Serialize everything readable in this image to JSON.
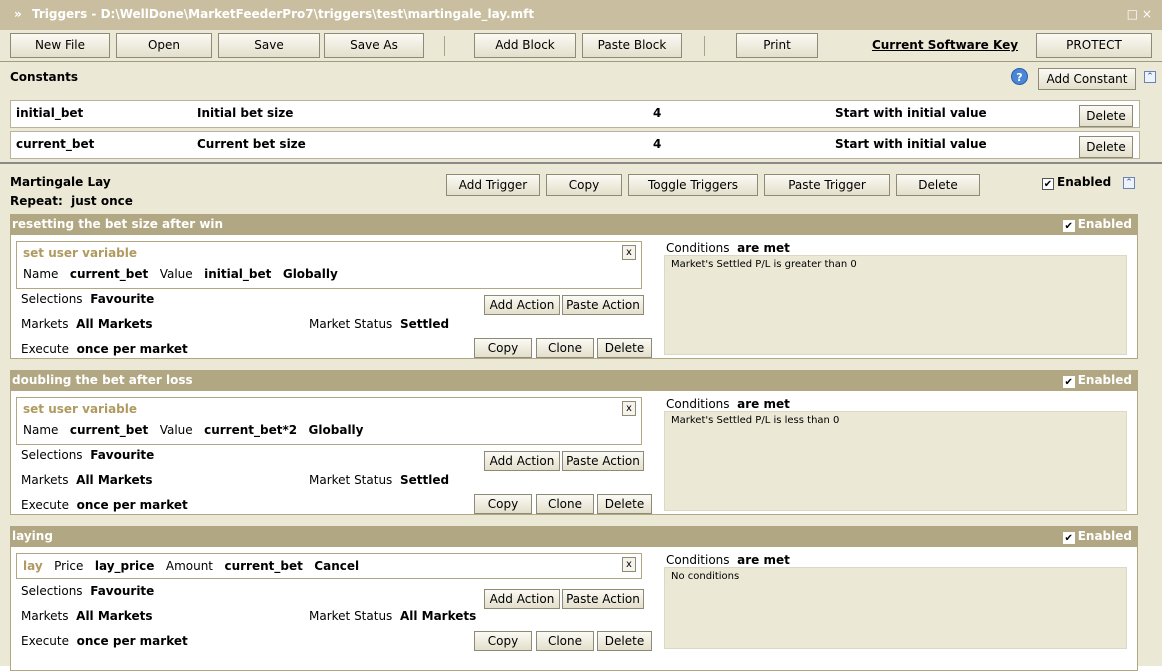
{
  "window": {
    "icon": "»",
    "title": "Triggers - D:\\WellDone\\MarketFeederPro7\\triggers\\test\\martingale_lay.mft",
    "controls": "□ ×"
  },
  "toolbar": {
    "new_file": "New File",
    "open": "Open",
    "save": "Save",
    "save_as": "Save As",
    "add_block": "Add Block",
    "paste_block": "Paste Block",
    "print": "Print",
    "current_key": "Current Software Key",
    "protect": "PROTECT"
  },
  "constants": {
    "title": "Constants",
    "help": "?",
    "add_constant": "Add Constant",
    "collapse": "⌃",
    "rows": [
      {
        "name": "initial_bet",
        "description": "Initial bet size",
        "value": "4",
        "mode": "Start with initial value",
        "delete": "Delete"
      },
      {
        "name": "current_bet",
        "description": "Current bet size",
        "value": "4",
        "mode": "Start with initial value",
        "delete": "Delete"
      }
    ]
  },
  "block": {
    "title": "Martingale Lay",
    "repeat_label": "Repeat:",
    "repeat_value": "just once",
    "enabled_label": "Enabled",
    "check": "✔",
    "collapse": "⌃",
    "buttons": {
      "add_trigger": "Add Trigger",
      "copy": "Copy",
      "toggle": "Toggle Triggers",
      "paste": "Paste Trigger",
      "delete": "Delete"
    }
  },
  "common": {
    "enabled": "Enabled",
    "check": "✔",
    "close": "x",
    "name_label": "Name",
    "value_label": "Value",
    "selections_label": "Selections",
    "markets_label": "Markets",
    "market_status_label": "Market Status",
    "execute_label": "Execute",
    "add_action": "Add Action",
    "paste_action": "Paste Action",
    "copy": "Copy",
    "clone": "Clone",
    "delete": "Delete",
    "conditions_label": "Conditions",
    "conditions_mode": "are met",
    "price_label": "Price",
    "amount_label": "Amount"
  },
  "triggers": [
    {
      "name": "resetting the bet size after win",
      "action": {
        "type": "set user variable",
        "name": "current_bet",
        "value": "initial_bet",
        "scope": "Globally"
      },
      "selections": "Favourite",
      "markets": "All Markets",
      "market_status": "Settled",
      "execute": "once per market",
      "condition": "Market's Settled P/L is greater than 0"
    },
    {
      "name": "doubling the bet after loss",
      "action": {
        "type": "set user variable",
        "name": "current_bet",
        "value": "current_bet*2",
        "scope": "Globally"
      },
      "selections": "Favourite",
      "markets": "All Markets",
      "market_status": "Settled",
      "execute": "once per market",
      "condition": "Market's Settled P/L is less than 0"
    },
    {
      "name": "laying",
      "action": {
        "type": "lay",
        "price": "lay_price",
        "amount": "current_bet",
        "mode": "Cancel"
      },
      "selections": "Favourite",
      "markets": "All Markets",
      "market_status": "All Markets",
      "execute": "once per market",
      "condition": "No conditions"
    }
  ]
}
